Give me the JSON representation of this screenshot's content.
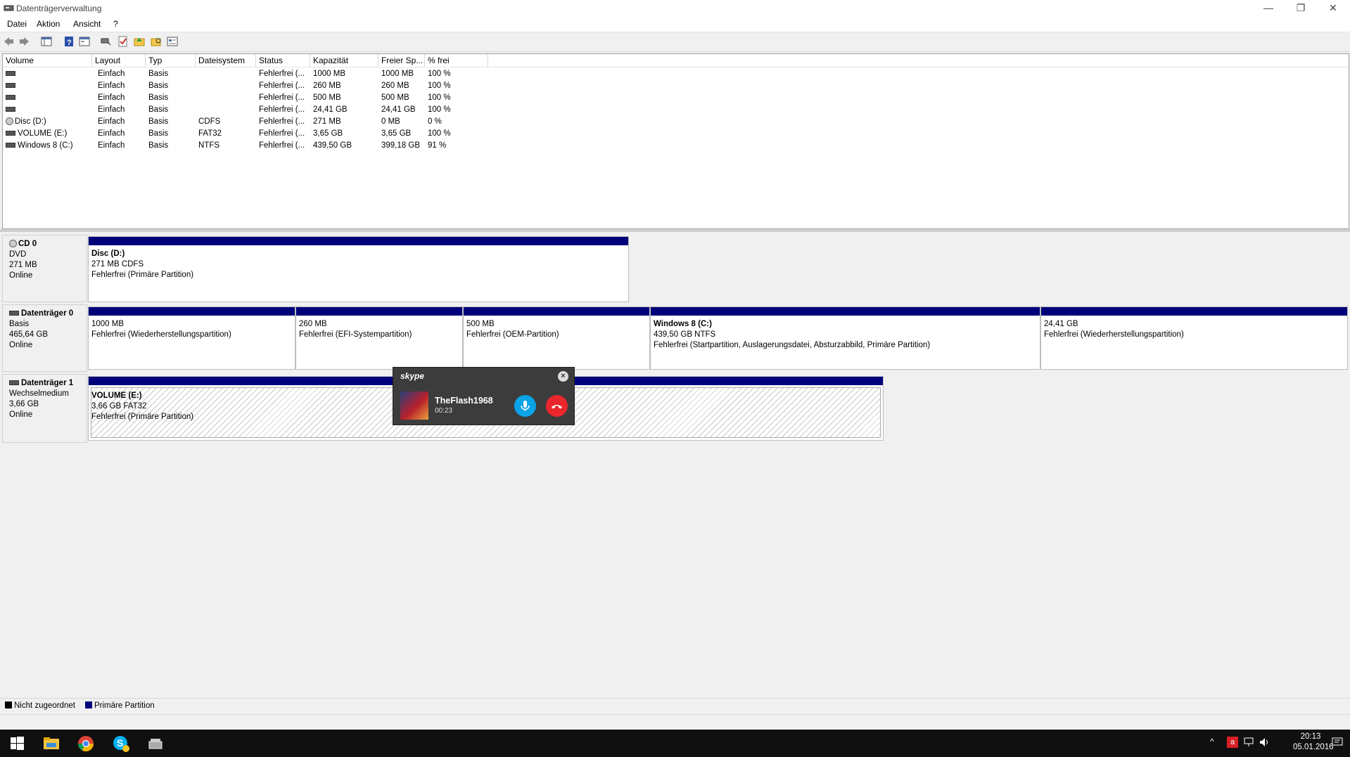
{
  "window": {
    "title": "Datenträgerverwaltung"
  },
  "menu": [
    "Datei",
    "Aktion",
    "Ansicht",
    "?"
  ],
  "table": {
    "columns": [
      "Volume",
      "Layout",
      "Typ",
      "Dateisystem",
      "Status",
      "Kapazität",
      "Freier Sp...",
      "% frei"
    ],
    "rows": [
      {
        "volume": "",
        "layout": "Einfach",
        "typ": "Basis",
        "fs": "",
        "status": "Fehlerfrei (...",
        "cap": "1000 MB",
        "free": "1000 MB",
        "pct": "100 %"
      },
      {
        "volume": "",
        "layout": "Einfach",
        "typ": "Basis",
        "fs": "",
        "status": "Fehlerfrei (...",
        "cap": "260 MB",
        "free": "260 MB",
        "pct": "100 %"
      },
      {
        "volume": "",
        "layout": "Einfach",
        "typ": "Basis",
        "fs": "",
        "status": "Fehlerfrei (...",
        "cap": "500 MB",
        "free": "500 MB",
        "pct": "100 %"
      },
      {
        "volume": "",
        "layout": "Einfach",
        "typ": "Basis",
        "fs": "",
        "status": "Fehlerfrei (...",
        "cap": "24,41 GB",
        "free": "24,41 GB",
        "pct": "100 %"
      },
      {
        "volume": "Disc (D:)",
        "layout": "Einfach",
        "typ": "Basis",
        "fs": "CDFS",
        "status": "Fehlerfrei (...",
        "cap": "271 MB",
        "free": "0 MB",
        "pct": "0 %"
      },
      {
        "volume": "VOLUME (E:)",
        "layout": "Einfach",
        "typ": "Basis",
        "fs": "FAT32",
        "status": "Fehlerfrei (...",
        "cap": "3,65 GB",
        "free": "3,65 GB",
        "pct": "100 %"
      },
      {
        "volume": "Windows 8 (C:)",
        "layout": "Einfach",
        "typ": "Basis",
        "fs": "NTFS",
        "status": "Fehlerfrei (...",
        "cap": "439,50 GB",
        "free": "399,18 GB",
        "pct": "91 %"
      }
    ]
  },
  "disks": {
    "cd0": {
      "name": "CD 0",
      "type": "DVD",
      "size": "271 MB",
      "state": "Online",
      "partition": {
        "title": "Disc  (D:)",
        "size": "271 MB CDFS",
        "status": "Fehlerfrei (Primäre Partition)"
      }
    },
    "disk0": {
      "name": "Datenträger 0",
      "type": "Basis",
      "size": "465,64 GB",
      "state": "Online",
      "partitions": [
        {
          "title": "",
          "size": "1000 MB",
          "status": "Fehlerfrei (Wiederherstellungspartition)"
        },
        {
          "title": "",
          "size": "260 MB",
          "status": "Fehlerfrei (EFI-Systempartition)"
        },
        {
          "title": "",
          "size": "500 MB",
          "status": "Fehlerfrei (OEM-Partition)"
        },
        {
          "title": "Windows 8  (C:)",
          "size": "439,50 GB NTFS",
          "status": "Fehlerfrei (Startpartition, Auslagerungsdatei, Absturzabbild, Primäre Partition)"
        },
        {
          "title": "",
          "size": "24,41 GB",
          "status": "Fehlerfrei (Wiederherstellungspartition)"
        }
      ]
    },
    "disk1": {
      "name": "Datenträger 1",
      "type": "Wechselmedium",
      "size": "3,66 GB",
      "state": "Online",
      "partition": {
        "title": "VOLUME  (E:)",
        "size": "3,66 GB FAT32",
        "status": "Fehlerfrei (Primäre Partition)"
      }
    }
  },
  "legend": {
    "unallocated": "Nicht zugeordnet",
    "primary": "Primäre Partition"
  },
  "skype": {
    "logo": "skype",
    "caller": "TheFlash1968",
    "duration": "00:23"
  },
  "taskbar": {
    "time": "20:13",
    "date": "05.01.2016"
  },
  "colors": {
    "partition_bar": "#00007b",
    "taskbar": "#101010",
    "skype_mic": "#0aa3e6",
    "skype_hangup": "#e8262c"
  }
}
